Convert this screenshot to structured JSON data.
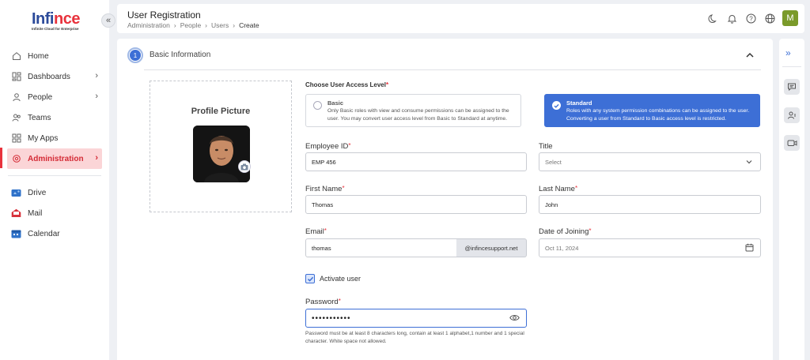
{
  "brand": {
    "logo_main": "Infi",
    "logo_accent": "nce",
    "tagline": "Infinite Cloud for Enterprise"
  },
  "sidebar": {
    "collapse_icon": "chevron-double-left-icon",
    "items": [
      {
        "label": "Home",
        "icon": "home-icon",
        "has_children": false
      },
      {
        "label": "Dashboards",
        "icon": "dashboard-icon",
        "has_children": true
      },
      {
        "label": "People",
        "icon": "person-icon",
        "has_children": true
      },
      {
        "label": "Teams",
        "icon": "teams-icon",
        "has_children": false
      },
      {
        "label": "My Apps",
        "icon": "apps-icon",
        "has_children": false
      },
      {
        "label": "Administration",
        "icon": "admin-icon",
        "has_children": true,
        "active": true
      }
    ],
    "apps": [
      {
        "label": "Drive",
        "icon": "drive-icon"
      },
      {
        "label": "Mail",
        "icon": "mail-icon"
      },
      {
        "label": "Calendar",
        "icon": "calendar-icon"
      }
    ]
  },
  "header": {
    "title": "User Registration",
    "breadcrumb": [
      "Administration",
      "People",
      "Users",
      "Create"
    ],
    "icons": [
      "moon-icon",
      "bell-icon",
      "help-icon",
      "globe-icon"
    ],
    "avatar_letter": "M",
    "avatar_color": "#7a9a2a"
  },
  "section": {
    "step_number": "1",
    "title": "Basic Information"
  },
  "profile": {
    "label": "Profile Picture"
  },
  "access": {
    "label": "Choose User Access Level",
    "basic": {
      "title": "Basic",
      "description": "Only Basic roles with view and consume permissions can be assigned to the user. You may convert user access level from Basic to Standard at anytime.",
      "selected": false
    },
    "standard": {
      "title": "Standard",
      "description": "Roles with any system permission combinations can be assigned to the user. Converting a user from Standard to Basic access level is restricted.",
      "selected": true
    }
  },
  "form": {
    "employee_id": {
      "label": "Employee ID",
      "value": "EMP 456"
    },
    "title": {
      "label": "Title",
      "value": "Select"
    },
    "first_name": {
      "label": "First Name",
      "value": "Thomas"
    },
    "last_name": {
      "label": "Last Name",
      "value": "John"
    },
    "email": {
      "label": "Email",
      "value": "thomas",
      "suffix": "@infincesupport.net"
    },
    "date_of_joining": {
      "label": "Date of Joining",
      "value": "Oct 11, 2024"
    },
    "activate_user": {
      "label": "Activate user",
      "checked": true
    },
    "password": {
      "label": "Password",
      "value": "•••••••••••",
      "hint": "Password must be at least 8 characters long, contain at least 1 alphabet,1 number and 1 special character. White space not allowed."
    }
  },
  "colors": {
    "primary": "#3d6fd6",
    "danger": "#e8323c",
    "active_bg": "#fbd5d7"
  },
  "right_rail": {
    "expand_icon": "chevron-double-right-icon",
    "buttons": [
      "chat-icon",
      "user-card-icon",
      "video-icon"
    ]
  }
}
